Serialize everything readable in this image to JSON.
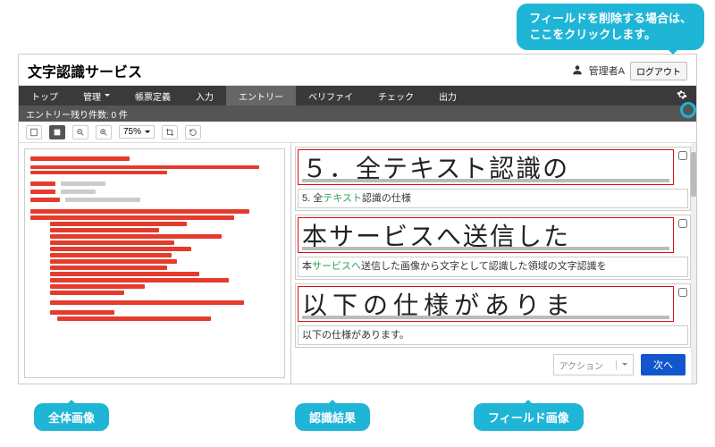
{
  "callouts": {
    "delete_field": "フィールドを削除する場合は、\nここをクリックします。",
    "full_image": "全体画像",
    "result": "認識結果",
    "field_image": "フィールド画像"
  },
  "header": {
    "title": "文字認識サービス",
    "user_name": "管理者A",
    "logout": "ログアウト"
  },
  "navbar": {
    "items": [
      {
        "label": "トップ"
      },
      {
        "label": "管理",
        "dropdown": true
      },
      {
        "label": "帳票定義"
      },
      {
        "label": "入力"
      },
      {
        "label": "エントリー",
        "active": true
      },
      {
        "label": "ベリファイ"
      },
      {
        "label": "チェック"
      },
      {
        "label": "出力"
      }
    ]
  },
  "subbar": {
    "text": "エントリー残り件数: 0 件"
  },
  "toolbar": {
    "zoom_value": "75%",
    "zoom_out": "－",
    "zoom_in": "＋"
  },
  "entries": [
    {
      "image_text": "５．全テキスト認識の",
      "result_prefix": "5. 全",
      "result_hl": "テキスト",
      "result_suffix": "認識の仕様"
    },
    {
      "image_text": "本サービスへ送信した",
      "result_prefix": "本",
      "result_hl": "サービスへ",
      "result_suffix": "送信した画像から文字として認識した領域の文字認識を"
    },
    {
      "image_text": "以下の仕様がありま",
      "result_prefix": "以下の仕様があります。",
      "result_hl": "",
      "result_suffix": ""
    }
  ],
  "footer": {
    "action_label": "アクション",
    "next": "次へ"
  }
}
